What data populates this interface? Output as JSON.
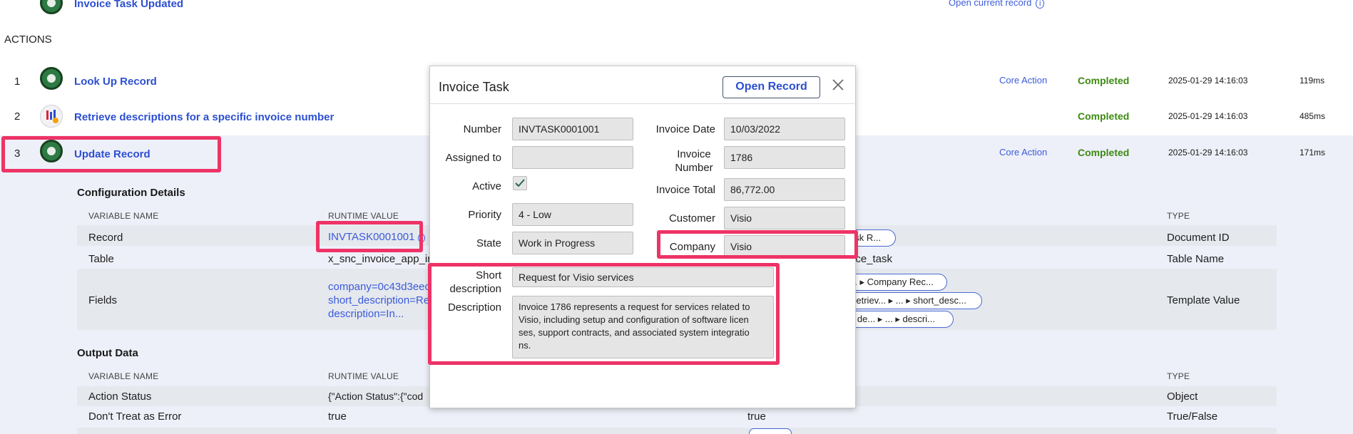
{
  "top": {
    "prev_action_label": "Invoice Task Updated",
    "open_current_record": "Open current record",
    "actions_heading": "ACTIONS"
  },
  "actions": [
    {
      "num": "1",
      "name": "Look Up Record",
      "type": "Core Action",
      "status": "Completed",
      "time": "2025-01-29 14:16:03",
      "duration": "119ms"
    },
    {
      "num": "2",
      "name": "Retrieve descriptions for a specific invoice number",
      "type": "",
      "status": "Completed",
      "time": "2025-01-29 14:16:03",
      "duration": "485ms"
    },
    {
      "num": "3",
      "name": "Update Record",
      "type": "Core Action",
      "status": "Completed",
      "time": "2025-01-29 14:16:03",
      "duration": "171ms"
    }
  ],
  "config": {
    "heading": "Configuration Details",
    "col_variable": "VARIABLE NAME",
    "col_runtime": "RUNTIME VALUE",
    "col_type": "TYPE",
    "rows": [
      {
        "name": "Record",
        "runtime": "INVTASK0001001",
        "data_pill": "ask R...",
        "type": "Document ID"
      },
      {
        "name": "Table",
        "runtime": "x_snc_invoice_app_inv",
        "data": "ice_task",
        "type": "Table Name"
      },
      {
        "name": "Fields",
        "runtime_lines": [
          "company=0c43d3eec",
          "short_description=Re",
          "description=In..."
        ],
        "pills": [
          "... ▸ Company Rec...",
          "Retriev... ▸ ... ▸ short_desc...",
          "e de... ▸ ... ▸ descri..."
        ],
        "type": "Template Value"
      }
    ]
  },
  "output": {
    "heading": "Output Data",
    "col_variable": "VARIABLE NAME",
    "col_runtime": "RUNTIME VALUE",
    "col_type": "TYPE",
    "rows": [
      {
        "name": "Action Status",
        "runtime": "{\"Action Status\":{\"cod",
        "type": "Object"
      },
      {
        "name": "Don't Treat as Error",
        "runtime": "true",
        "data": "true",
        "type": "True/False"
      }
    ]
  },
  "modal": {
    "title": "Invoice Task",
    "open_record": "Open Record",
    "fields": {
      "number_label": "Number",
      "number": "INVTASK0001001",
      "assigned_label": "Assigned to",
      "assigned": "",
      "active_label": "Active",
      "priority_label": "Priority",
      "priority": "4 - Low",
      "state_label": "State",
      "state": "Work in Progress",
      "invoice_date_label": "Invoice Date",
      "invoice_date": "10/03/2022",
      "invoice_number_label_1": "Invoice",
      "invoice_number_label_2": "Number",
      "invoice_number": "1786",
      "invoice_total_label": "Invoice Total",
      "invoice_total": "86,772.00",
      "customer_label": "Customer",
      "customer": "Visio",
      "company_label": "Company",
      "company": "Visio",
      "short_desc_label_1": "Short",
      "short_desc_label_2": "description",
      "short_desc": "Request for Visio services",
      "description_label": "Description",
      "description_lines": [
        "Invoice 1786 represents a request for services related to",
        "Visio, including setup and configuration of software licen",
        "ses, support contracts, and associated system integratio",
        "ns."
      ]
    }
  },
  "colors": {
    "accent": "#3b5bdb",
    "status_green": "#3d8a10",
    "highlight": "#ee3366"
  }
}
